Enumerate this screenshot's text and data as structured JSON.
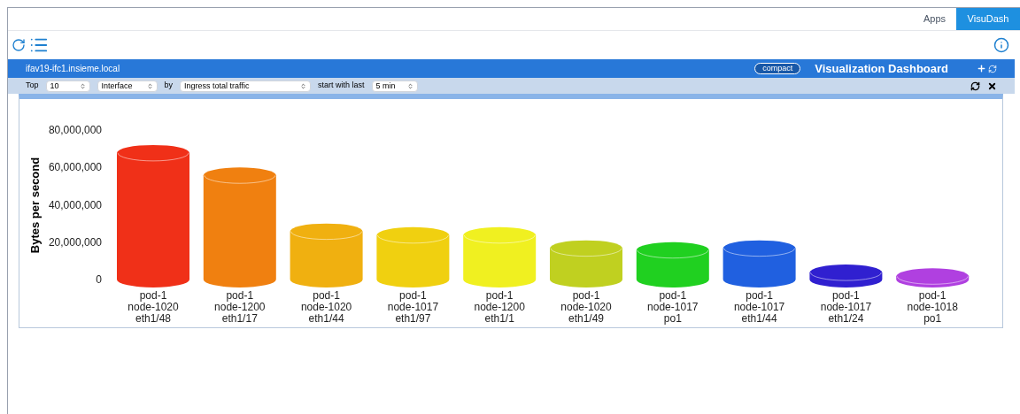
{
  "top_tabs": [
    {
      "label": "Apps",
      "selected": false
    },
    {
      "label": "VisuDash",
      "selected": true
    }
  ],
  "header": {
    "host": "ifav19-ifc1.insieme.local",
    "badge": "compact",
    "title": "Visualization Dashboard"
  },
  "filters": {
    "top_label": "Top",
    "top_value": "10",
    "group_value": "Interface",
    "by_label": "by",
    "metric_value": "Ingress total traffic",
    "window_label": "start with last",
    "window_value": "5 min"
  },
  "chart": {
    "chart_data": {
      "type": "bar",
      "ylabel": "Bytes per second",
      "categories": [
        "pod-1\nnode-1020\neth1/48",
        "pod-1\nnode-1200\neth1/17",
        "pod-1\nnode-1020\neth1/44",
        "pod-1\nnode-1017\neth1/97",
        "pod-1\nnode-1200\neth1/1",
        "pod-1\nnode-1020\neth1/49",
        "pod-1\nnode-1017\npo1",
        "pod-1\nnode-1017\neth1/44",
        "pod-1\nnode-1017\neth1/24",
        "pod-1\nnode-1018\npo1"
      ],
      "series": [
        {
          "colors": [
            "#f03018",
            "#f08010",
            "#f0b010",
            "#f0d010",
            "#f0f020",
            "#c0d020",
            "#20d020",
            "#2060e0",
            "#3020d0",
            "#b040e0"
          ],
          "values": [
            72000000,
            60000000,
            30000000,
            28000000,
            28000000,
            21000000,
            20000000,
            21000000,
            8000000,
            6000000
          ]
        }
      ],
      "ylim": [
        0,
        80000000
      ],
      "yticks": [
        {
          "value": 0,
          "label": "0"
        },
        {
          "value": 20000000,
          "label": "20,000,000"
        },
        {
          "value": 40000000,
          "label": "40,000,000"
        },
        {
          "value": 60000000,
          "label": "60,000,000"
        },
        {
          "value": 80000000,
          "label": "80,000,000"
        }
      ]
    }
  }
}
